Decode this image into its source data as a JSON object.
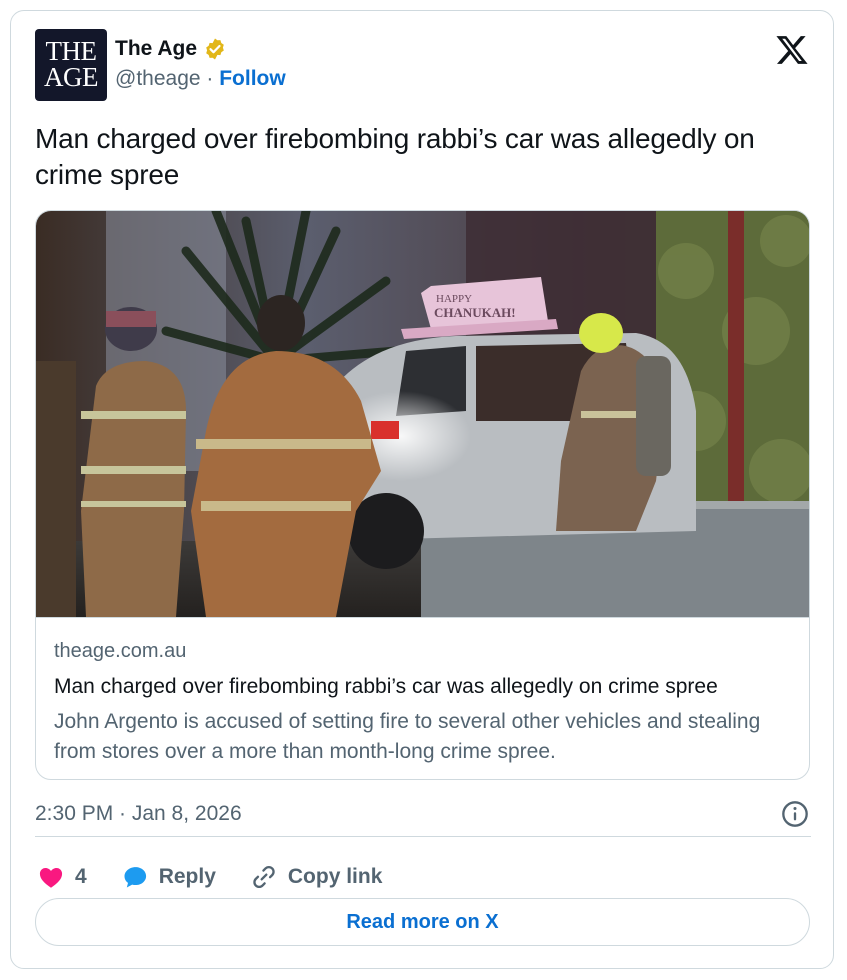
{
  "account": {
    "logo_line1": "THE",
    "logo_line2": "AGE",
    "name": "The Age",
    "handle": "@theage",
    "separator": " · ",
    "follow_label": "Follow"
  },
  "tweet": {
    "text": "Man charged over firebombing rabbi’s car was allegedly on crime spree"
  },
  "link_card": {
    "domain": "theage.com.au",
    "title": "Man charged over firebombing rabbi’s car was allegedly on crime spree",
    "description": "John Argento is accused of setting fire to several other vehicles and stealing from stores over a more than month-long crime spree.",
    "image_sign_line1": "HAPPY",
    "image_sign_line2": "CHANUKAH!"
  },
  "timestamp": "2:30 PM · Jan 8, 2026",
  "actions": {
    "like_count": "4",
    "reply_label": "Reply",
    "copy_label": "Copy link"
  },
  "read_more_label": "Read more on X",
  "colors": {
    "accent": "#0a6fd1",
    "like": "#f91880",
    "reply_icon": "#1d9bf0",
    "verified": "#e2b719",
    "muted": "#536471",
    "border": "#cfd9de"
  },
  "icons": [
    "verified-badge-icon",
    "x-logo-icon",
    "info-icon",
    "heart-icon",
    "reply-bubble-icon",
    "link-icon"
  ]
}
